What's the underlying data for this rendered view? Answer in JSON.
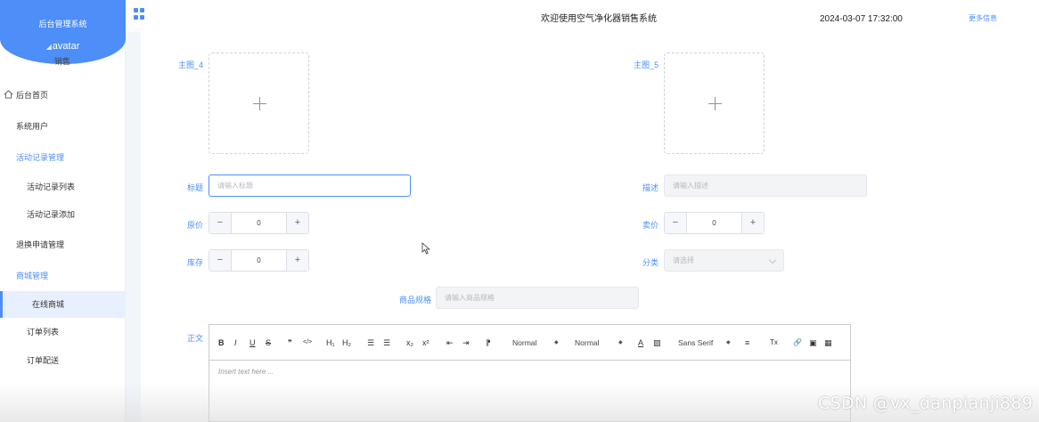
{
  "sidebar": {
    "system_name": "后台管理系统",
    "avatar_alt": "avatar",
    "role": "销售",
    "items": [
      {
        "label": "后台首页",
        "icon": "home-icon"
      },
      {
        "label": "系统用户"
      },
      {
        "label": "活动记录管理"
      },
      {
        "label": "活动记录列表"
      },
      {
        "label": "活动记录添加"
      },
      {
        "label": "退换申请管理"
      },
      {
        "label": "商城管理"
      },
      {
        "label": "在线商城"
      },
      {
        "label": "订单列表"
      },
      {
        "label": "订单配送"
      }
    ]
  },
  "header": {
    "welcome": "欢迎使用空气净化器销售系统",
    "datetime": "2024-03-07 17:32:00",
    "more": "更多信息"
  },
  "form": {
    "main_image_4_label": "主图_4",
    "main_image_5_label": "主图_5",
    "title_label": "标题",
    "title_placeholder": "请输入标题",
    "desc_label": "描述",
    "desc_placeholder": "请输入描述",
    "original_price_label": "原价",
    "original_price_value": "0",
    "sale_price_label": "卖价",
    "sale_price_value": "0",
    "stock_label": "库存",
    "stock_value": "0",
    "category_label": "分类",
    "category_placeholder": "请选择",
    "spec_label": "商品规格",
    "spec_placeholder": "请输入商品规格",
    "body_label": "正文"
  },
  "editor": {
    "toolbar": {
      "bold": "B",
      "italic": "I",
      "underline": "U",
      "strike": "S",
      "quote": "❞",
      "code": "</>",
      "h1": "H₁",
      "h2": "H₂",
      "ordered_list": "☰",
      "bullet_list": "☰",
      "subscript": "x₂",
      "superscript": "x²",
      "outdent": "⇤",
      "indent": "⇥",
      "direction": "⁋",
      "size": "Normal",
      "header": "Normal",
      "color": "A",
      "background": "▨",
      "font": "Sans Serif",
      "align": "≡",
      "clean": "Tx",
      "link": "🔗",
      "image": "▣",
      "video": "▦"
    },
    "placeholder": "Insert text here ..."
  },
  "watermark": "CSDN @vx_danpianji889",
  "colors": {
    "accent": "#4d8ef8",
    "border": "#dcdfe6",
    "disabled_bg": "#f3f4f6"
  }
}
